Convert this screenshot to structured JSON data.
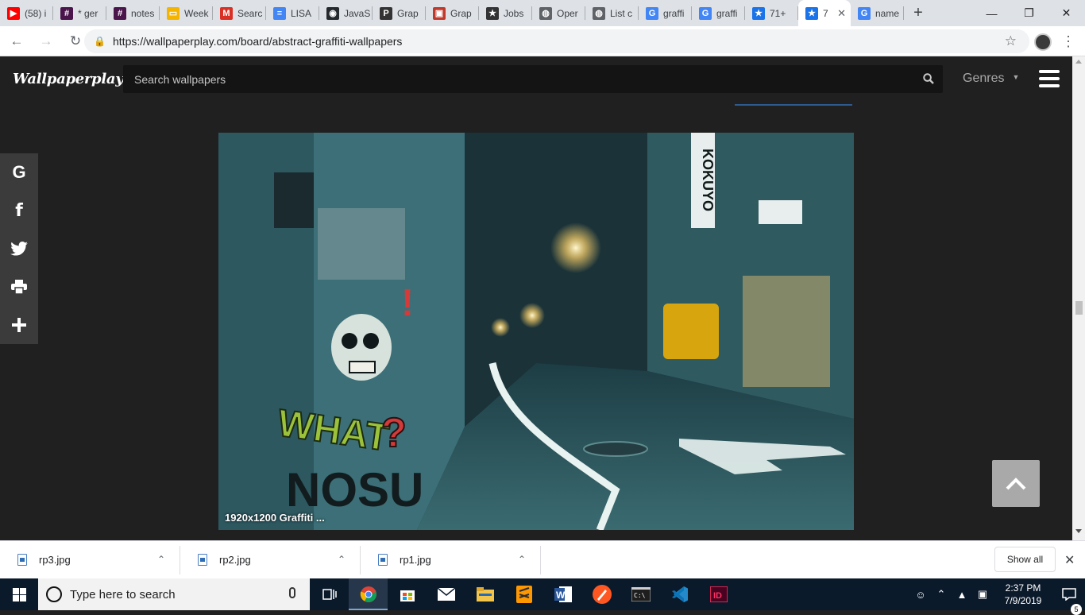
{
  "browser": {
    "tabs": [
      {
        "title": "(58) i",
        "icon": "youtube-icon",
        "color": "#ff0000",
        "glyph": "▶"
      },
      {
        "title": "* ger",
        "icon": "slack-icon",
        "color": "#4a154b",
        "glyph": "#"
      },
      {
        "title": "notes",
        "icon": "slack-icon",
        "color": "#4a154b",
        "glyph": "#"
      },
      {
        "title": "Week",
        "icon": "slides-icon",
        "color": "#f4b400",
        "glyph": "▭"
      },
      {
        "title": "Searc",
        "icon": "gmail-icon",
        "color": "#d93025",
        "glyph": "M"
      },
      {
        "title": "LISA",
        "icon": "docs-icon",
        "color": "#4285f4",
        "glyph": "≡"
      },
      {
        "title": "JavaS",
        "icon": "github-icon",
        "color": "#24292e",
        "glyph": "◉"
      },
      {
        "title": "Grap",
        "icon": "pinterest-icon",
        "color": "#333333",
        "glyph": "P"
      },
      {
        "title": "Grap",
        "icon": "bookmark-icon",
        "color": "#c0392b",
        "glyph": "▣"
      },
      {
        "title": "Jobs",
        "icon": "jobs-icon",
        "color": "#333333",
        "glyph": "★"
      },
      {
        "title": "Oper",
        "icon": "globe-icon",
        "color": "#5f6368",
        "glyph": "◍"
      },
      {
        "title": "List c",
        "icon": "globe-icon",
        "color": "#5f6368",
        "glyph": "◍"
      },
      {
        "title": "graffi",
        "icon": "google-icon",
        "color": "#4285f4",
        "glyph": "G"
      },
      {
        "title": "graffi",
        "icon": "google-icon",
        "color": "#4285f4",
        "glyph": "G"
      },
      {
        "title": "71+",
        "icon": "star-icon",
        "color": "#1a73e8",
        "glyph": "★"
      },
      {
        "title": "7",
        "icon": "star-icon",
        "color": "#1a73e8",
        "glyph": "★",
        "active": true
      },
      {
        "title": "name",
        "icon": "google-icon",
        "color": "#4285f4",
        "glyph": "G"
      }
    ],
    "url": "https://wallpaperplay.com/board/abstract-graffiti-wallpapers"
  },
  "site": {
    "logo": "Wallpaperplay",
    "search_placeholder": "Search wallpapers",
    "genres_label": "Genres",
    "share_buttons": [
      "google-icon",
      "facebook-icon",
      "twitter-icon",
      "print-icon",
      "plus-icon"
    ],
    "wallpaper_caption": "1920x1200 Graffiti ...",
    "accent_color": "#2e5a8f"
  },
  "downloads": {
    "items": [
      "rp3.jpg",
      "rp2.jpg",
      "rp1.jpg"
    ],
    "show_all_label": "Show all"
  },
  "taskbar": {
    "search_placeholder": "Type here to search",
    "time": "2:37 PM",
    "date": "7/9/2019",
    "notification_count": "5"
  }
}
